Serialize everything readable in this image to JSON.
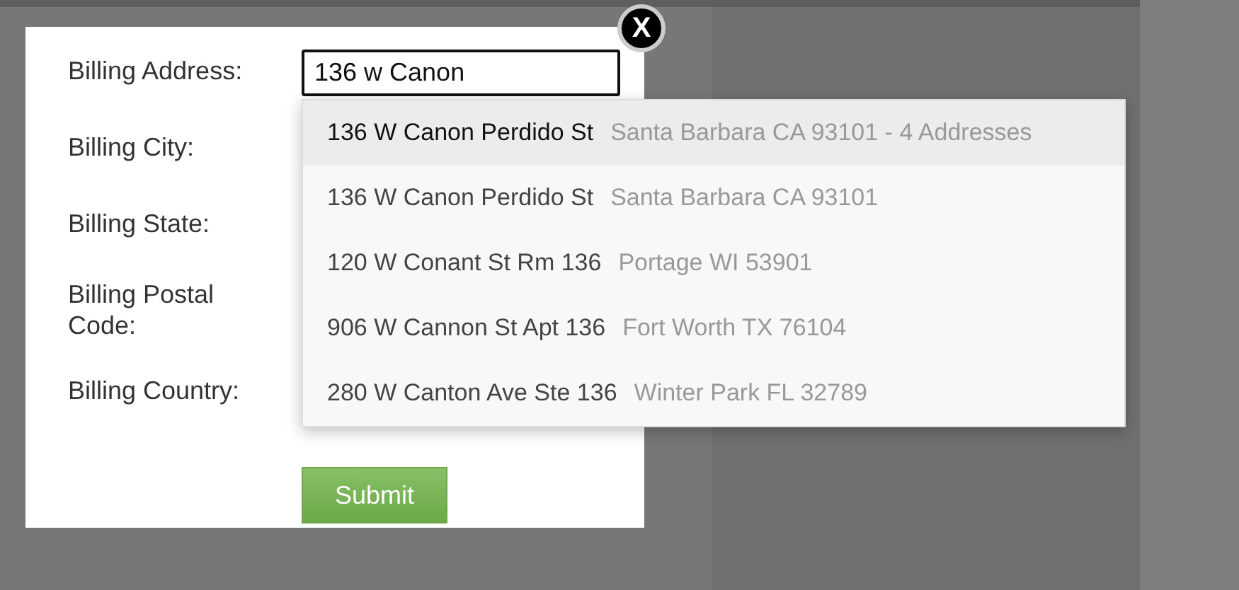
{
  "form": {
    "fields": [
      {
        "label": "Billing Address:",
        "value": "136 w Canon"
      },
      {
        "label": "Billing City:"
      },
      {
        "label": "Billing State:"
      },
      {
        "label": "Billing Postal Code:"
      },
      {
        "label": "Billing Country:"
      }
    ],
    "submit": "Submit",
    "close": "X"
  },
  "suggestions": [
    {
      "street": "136 W Canon Perdido St",
      "place": "Santa Barbara CA 93101 - 4 Addresses",
      "selected": true
    },
    {
      "street": "136 W Canon Perdido St",
      "place": "Santa Barbara CA 93101",
      "selected": false
    },
    {
      "street": "120 W Conant St Rm 136",
      "place": "Portage WI 53901",
      "selected": false
    },
    {
      "street": "906 W Cannon St Apt 136",
      "place": "Fort Worth TX 76104",
      "selected": false
    },
    {
      "street": "280 W Canton Ave Ste 136",
      "place": "Winter Park FL 32789",
      "selected": false
    }
  ]
}
